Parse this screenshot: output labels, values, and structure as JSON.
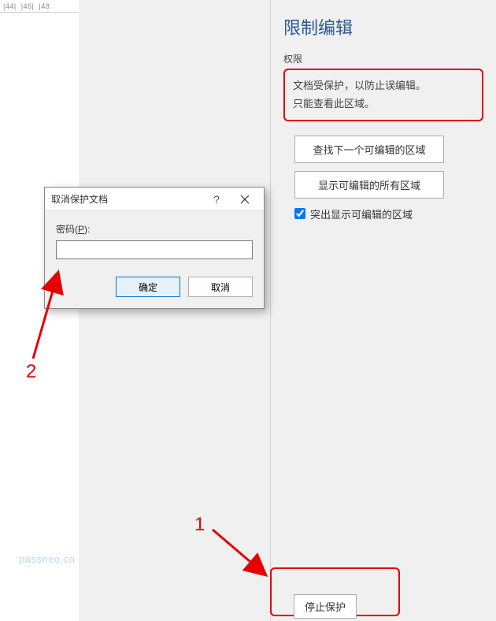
{
  "ruler": {
    "marks": [
      "|44|",
      "|46|",
      "|48"
    ]
  },
  "sidePanel": {
    "title": "限制编辑",
    "permissionsLabel": "权限",
    "protectionMsgLine1": "文档受保护，以防止误编辑。",
    "protectionMsgLine2": "只能查看此区域。",
    "findNextButton": "查找下一个可编辑的区域",
    "showAllButton": "显示可编辑的所有区域",
    "highlightCheckbox": "突出显示可编辑的区域",
    "highlightChecked": true,
    "stopProtectButton": "停止保护"
  },
  "dialog": {
    "title": "取消保护文档",
    "helpSymbol": "?",
    "passwordLabelPrefix": "密码(",
    "passwordLabelKey": "P",
    "passwordLabelSuffix": "):",
    "passwordValue": "",
    "okButton": "确定",
    "cancelButton": "取消"
  },
  "annotations": {
    "label1": "1",
    "label2": "2"
  },
  "watermark": "passneo.cn",
  "colors": {
    "accent": "#2b579a",
    "highlight": "#e60000",
    "buttonBorder": "#adadad"
  }
}
